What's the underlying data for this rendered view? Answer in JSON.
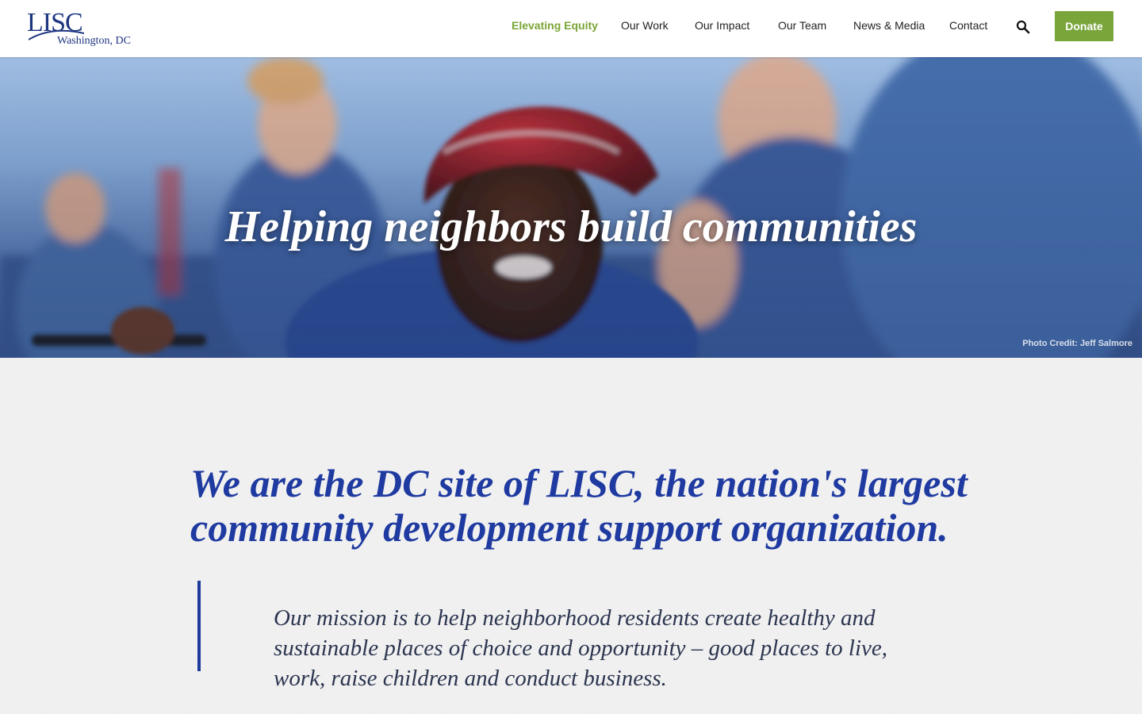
{
  "header": {
    "logo": {
      "name": "LISC",
      "sub": "Washington, DC"
    },
    "nav": [
      {
        "label": "Elevating Equity",
        "active": true
      },
      {
        "label": "Our Work"
      },
      {
        "label": "Our Impact"
      },
      {
        "label": "Our Team"
      },
      {
        "label": "News & Media"
      },
      {
        "label": "Contact"
      }
    ],
    "search_icon": "search-icon",
    "donate_label": "Donate"
  },
  "hero": {
    "title": "Helping neighbors build communities",
    "photo_credit": "Photo Credit: Jeff Salmore"
  },
  "main": {
    "headline": "We are the DC site of LISC, the nation's largest community development support organization.",
    "mission": "Our mission is to help neighborhood residents create healthy and sustainable places of choice and opportunity – good places to live, work, raise children and conduct business."
  },
  "colors": {
    "accent_green": "#79a53a",
    "brand_blue": "#1f3aa0",
    "background": "#efefef"
  }
}
